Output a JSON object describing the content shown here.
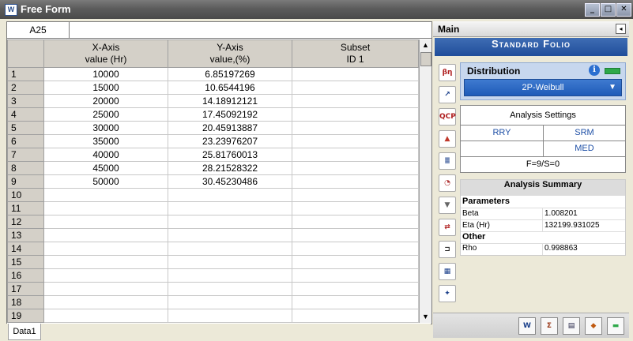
{
  "window": {
    "title": "Free Form"
  },
  "sheet": {
    "cell_ref": "A25",
    "headers": {
      "x_axis": [
        "X-Axis",
        "value (Hr)"
      ],
      "y_axis": [
        "Y-Axis",
        "value,(%)"
      ],
      "subset": [
        "Subset",
        "ID 1"
      ]
    },
    "rows": [
      {
        "n": "1",
        "x": "10000",
        "y": "6.85197269",
        "s": ""
      },
      {
        "n": "2",
        "x": "15000",
        "y": "10.6544196",
        "s": ""
      },
      {
        "n": "3",
        "x": "20000",
        "y": "14.18912121",
        "s": ""
      },
      {
        "n": "4",
        "x": "25000",
        "y": "17.45092192",
        "s": ""
      },
      {
        "n": "5",
        "x": "30000",
        "y": "20.45913887",
        "s": ""
      },
      {
        "n": "6",
        "x": "35000",
        "y": "23.23976207",
        "s": ""
      },
      {
        "n": "7",
        "x": "40000",
        "y": "25.81760013",
        "s": ""
      },
      {
        "n": "8",
        "x": "45000",
        "y": "28.21528322",
        "s": ""
      },
      {
        "n": "9",
        "x": "50000",
        "y": "30.45230486",
        "s": ""
      },
      {
        "n": "10",
        "x": "",
        "y": "",
        "s": ""
      },
      {
        "n": "11",
        "x": "",
        "y": "",
        "s": ""
      },
      {
        "n": "12",
        "x": "",
        "y": "",
        "s": ""
      },
      {
        "n": "13",
        "x": "",
        "y": "",
        "s": ""
      },
      {
        "n": "14",
        "x": "",
        "y": "",
        "s": ""
      },
      {
        "n": "15",
        "x": "",
        "y": "",
        "s": ""
      },
      {
        "n": "16",
        "x": "",
        "y": "",
        "s": ""
      },
      {
        "n": "17",
        "x": "",
        "y": "",
        "s": ""
      },
      {
        "n": "18",
        "x": "",
        "y": "",
        "s": ""
      },
      {
        "n": "19",
        "x": "",
        "y": "",
        "s": ""
      }
    ],
    "tab": "Data1"
  },
  "panel": {
    "header": "Main",
    "folio_title": "Standard Folio",
    "distribution": {
      "title": "Distribution",
      "selected": "2P-Weibull"
    },
    "settings": {
      "title": "Analysis Settings",
      "rry": "RRY",
      "srm": "SRM",
      "med": "MED",
      "fs": "F=9/S=0"
    },
    "summary": {
      "title": "Analysis Summary",
      "parameters_label": "Parameters",
      "beta_label": "Beta",
      "beta_value": "1.008201",
      "eta_label": "Eta (Hr)",
      "eta_value": "132199.931025",
      "other_label": "Other",
      "rho_label": "Rho",
      "rho_value": "0.998863"
    }
  }
}
